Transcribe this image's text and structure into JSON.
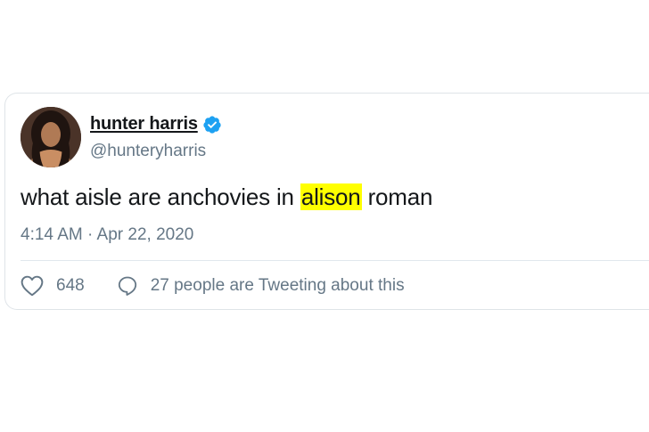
{
  "tweet": {
    "display_name": "hunter harris",
    "handle": "@hunteryharris",
    "verified": true,
    "text_before": "what aisle are anchovies in ",
    "text_highlight": "alison",
    "text_after": " roman",
    "timestamp": "4:14 AM · Apr 22, 2020",
    "like_count": "648",
    "discussion_text": "27 people are Tweeting about this"
  },
  "icons": {
    "verified": "verified-badge-icon",
    "like": "heart-icon",
    "reply": "speech-bubble-icon"
  },
  "colors": {
    "verified": "#1da1f2",
    "highlight": "#ffff00",
    "secondary_text": "#657786",
    "primary_text": "#14171a"
  }
}
